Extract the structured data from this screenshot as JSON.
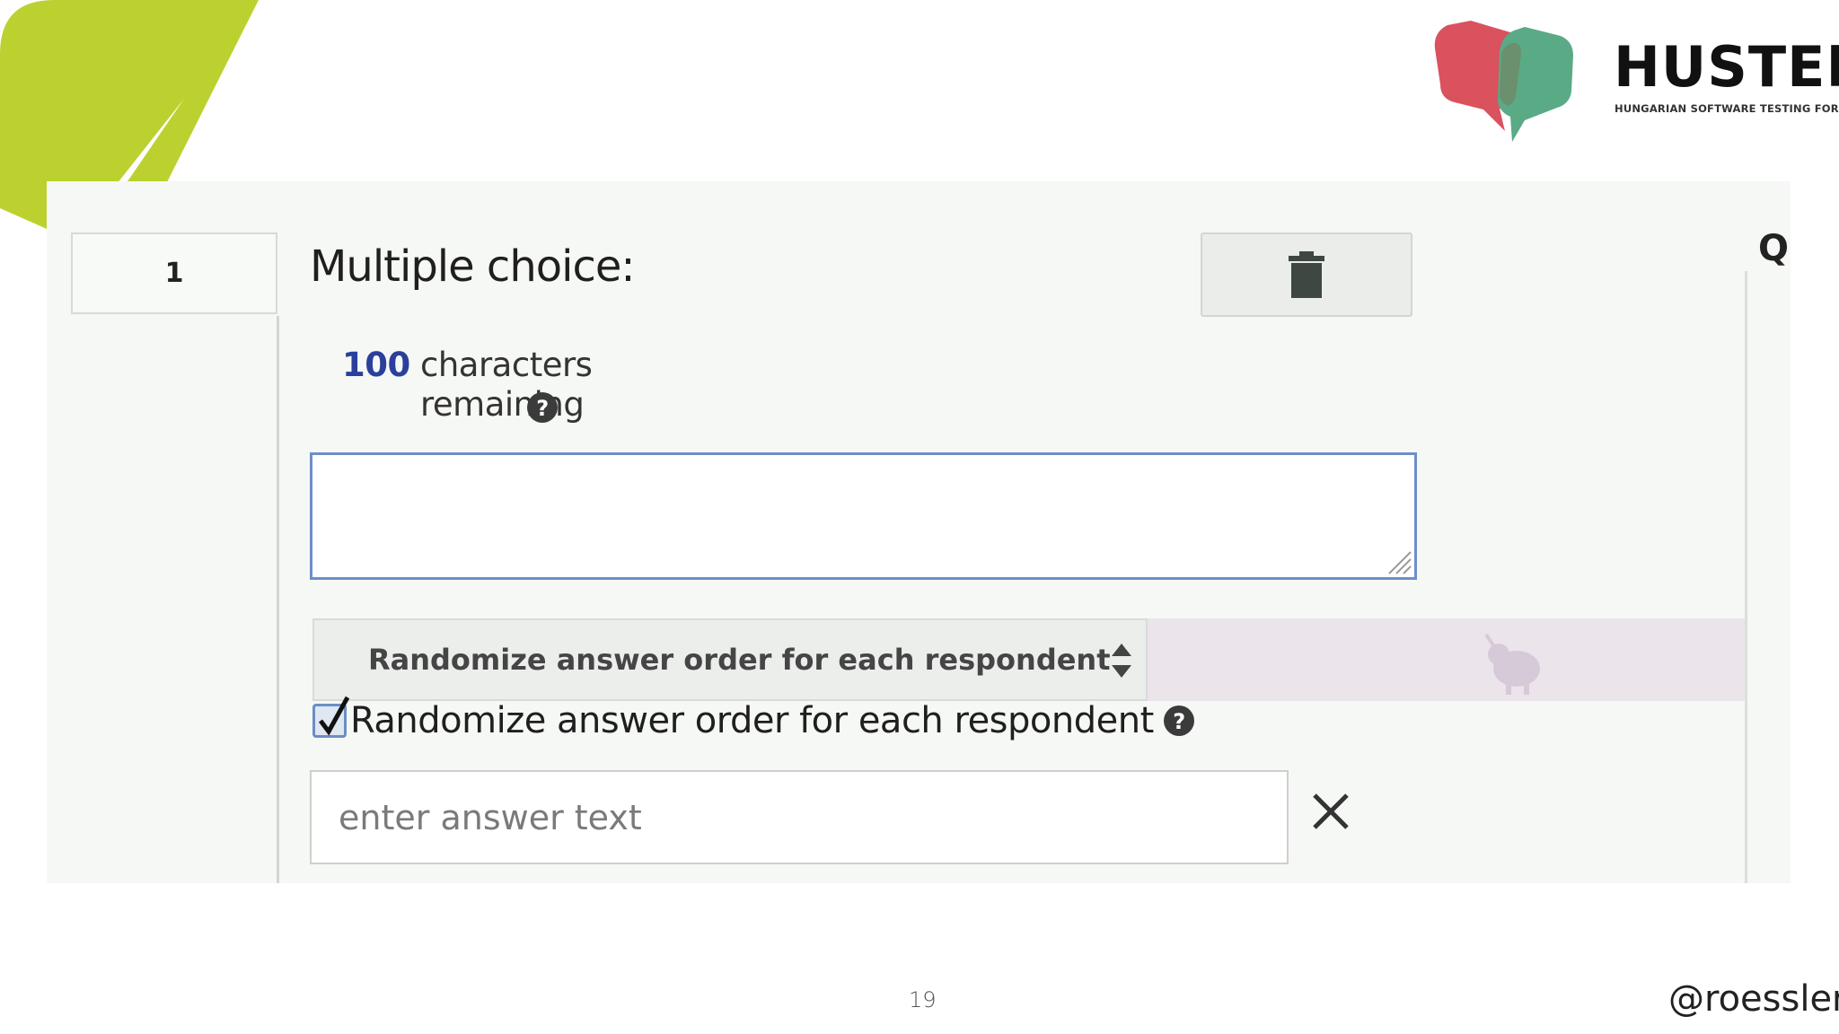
{
  "slide": {
    "brand": {
      "name": "HUSTEF",
      "tagline": "HUNGARIAN SOFTWARE TESTING FORUM",
      "colors": {
        "leaf_green": "#bcd12f",
        "bubble_red": "#d9525e",
        "bubble_green": "#5aaa86"
      }
    },
    "page_number": "19",
    "twitter_handle": "@roesslerj"
  },
  "form": {
    "question_number": "1",
    "question_type_title": "Multiple choice:",
    "delete_icon": "trash-icon",
    "characters_remaining_count": "100",
    "characters_remaining_label": "characters remaining",
    "question_text_value": "",
    "randomize_select_value": "Randomize answer order for each respondent",
    "randomize_checkbox_label": "Randomize answer order for each respondent",
    "randomize_checked": true,
    "answer_placeholder": "enter answer text",
    "remove_answer_icon": "close-icon",
    "edge_text": "Q"
  }
}
